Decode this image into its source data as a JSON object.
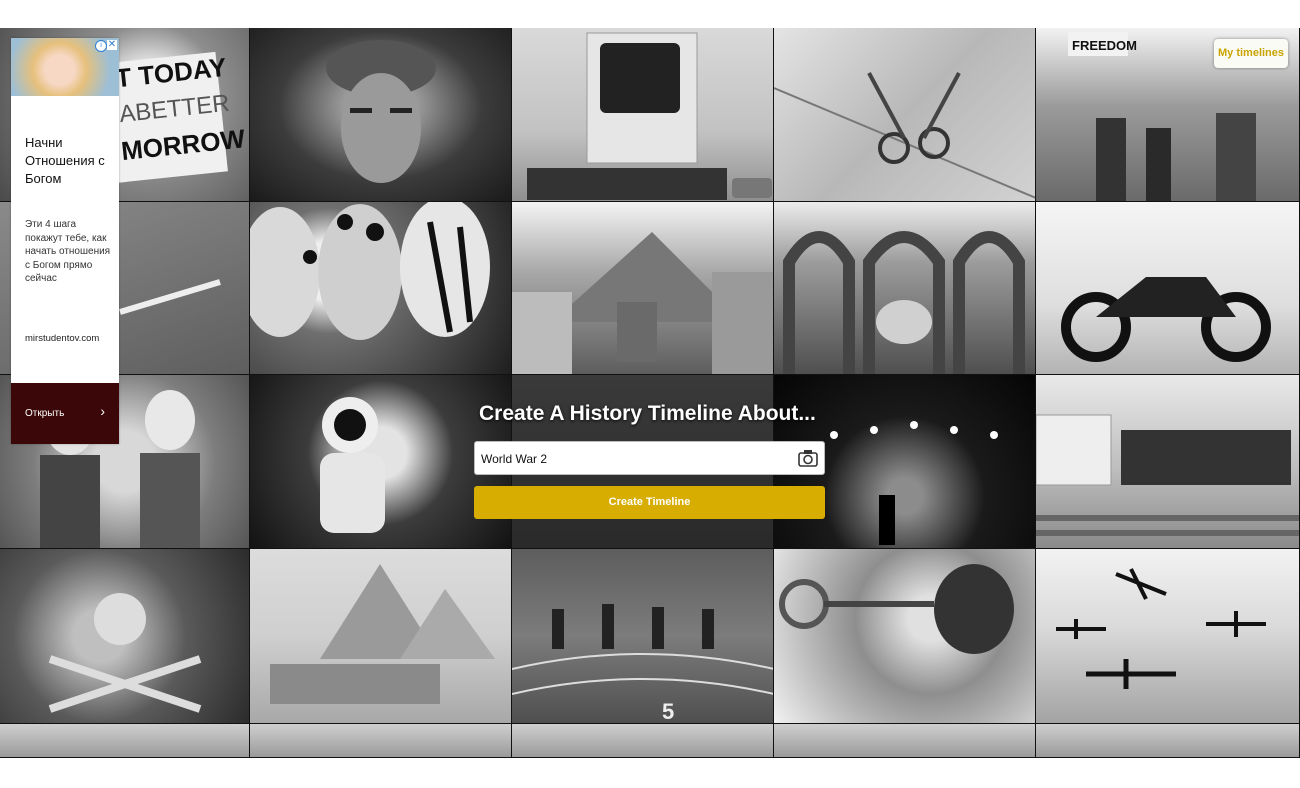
{
  "ad": {
    "headline": "Начни Отношения с Богом",
    "body": "Эти 4 шага покажут тебе, как начать отношения с Богом прямо сейчас",
    "domain": "mirstudentov.com",
    "cta_label": "Открыть",
    "cta_arrow": "›",
    "info_icon": "i",
    "close_icon": "✕"
  },
  "header": {
    "my_timelines_label": "My timelines"
  },
  "hero": {
    "title": "Create A History Timeline About...",
    "search_value": "World War 2",
    "create_button_label": "Create Timeline"
  },
  "tiles": [
    {
      "name": "protest-sign-tile",
      "sign": "T TODAY\nA BETTER\nMORROW"
    },
    {
      "name": "frida-portrait-tile"
    },
    {
      "name": "vintage-computer-tile"
    },
    {
      "name": "sewing-pattern-tile"
    },
    {
      "name": "civil-rights-march-tile",
      "sign": "FREEDOM"
    },
    {
      "name": "hand-tile"
    },
    {
      "name": "paper-lanterns-tile"
    },
    {
      "name": "volcano-street-tile"
    },
    {
      "name": "mosque-arches-tile"
    },
    {
      "name": "motorcycle-tile"
    },
    {
      "name": "women-tile"
    },
    {
      "name": "astronaut-tile"
    },
    {
      "name": "dark-room-tile"
    },
    {
      "name": "concert-stage-tile"
    },
    {
      "name": "classroom-tile"
    },
    {
      "name": "pirate-flag-tile"
    },
    {
      "name": "pyramids-sphinx-tile"
    },
    {
      "name": "running-race-tile",
      "lane": "5"
    },
    {
      "name": "trumpet-player-tile"
    },
    {
      "name": "warplanes-tile"
    },
    {
      "name": "bottom-tile-1"
    },
    {
      "name": "bottom-tile-2"
    },
    {
      "name": "bottom-tile-3"
    },
    {
      "name": "bottom-tile-4"
    },
    {
      "name": "bottom-tile-5"
    }
  ],
  "colors": {
    "accent": "#d6ad00",
    "ad_cta": "#3b0708"
  },
  "icons": {
    "search_icon": "camera-icon"
  }
}
